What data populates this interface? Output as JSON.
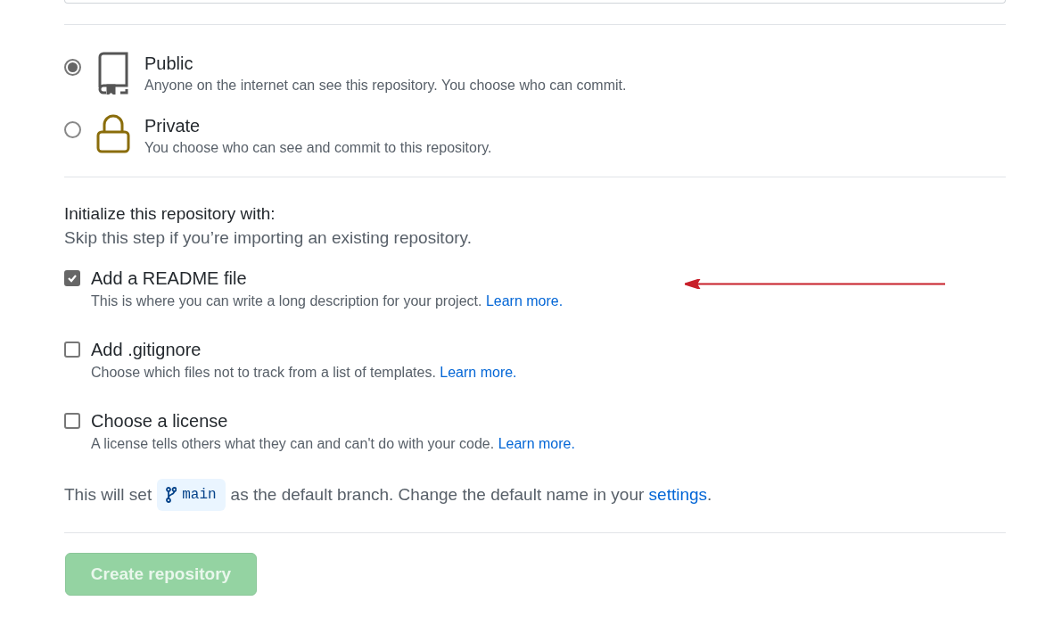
{
  "visibility": [
    {
      "kind": "public",
      "title": "Public",
      "description": "Anyone on the internet can see this repository. You choose who can commit.",
      "selected": true
    },
    {
      "kind": "private",
      "title": "Private",
      "description": "You choose who can see and commit to this repository.",
      "selected": false
    }
  ],
  "initialize": {
    "heading": "Initialize this repository with:",
    "subheading": "Skip this step if you’re importing an existing repository.",
    "options": [
      {
        "label": "Add a README file",
        "description": "This is where you can write a long description for your project.",
        "link": "Learn more.",
        "checked": true
      },
      {
        "label": "Add .gitignore",
        "description": "Choose which files not to track from a list of templates.",
        "link": "Learn more.",
        "checked": false
      },
      {
        "label": "Choose a license",
        "description": "A license tells others what they can and can't do with your code.",
        "link": "Learn more.",
        "checked": false
      }
    ]
  },
  "default_branch": {
    "before": "This will set",
    "branch": "main",
    "after": "as the default branch. Change the default name in your",
    "link": "settings",
    "end": "."
  },
  "submit": {
    "label": "Create repository",
    "disabled": true
  }
}
